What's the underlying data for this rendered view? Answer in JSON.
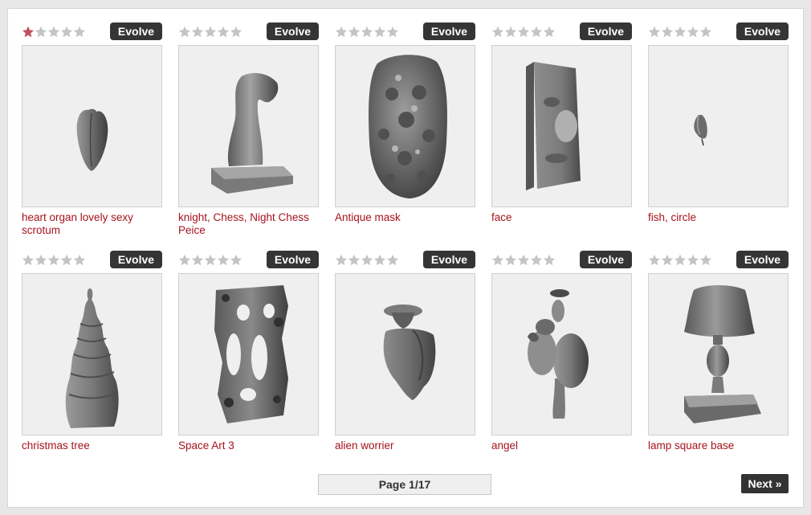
{
  "colors": {
    "star_empty": "#c4c4c4",
    "star_filled": "#c0505a",
    "title": "#a6121d",
    "button": "#353535"
  },
  "items": [
    {
      "title": "heart organ lovely sexy scrotum",
      "rating": 1,
      "evolve_label": "Evolve",
      "icon": "heart-shape"
    },
    {
      "title": "knight, Chess, Night Chess Peice",
      "rating": 0,
      "evolve_label": "Evolve",
      "icon": "chess-knight-shape"
    },
    {
      "title": "Antique mask",
      "rating": 0,
      "evolve_label": "Evolve",
      "icon": "mask-shape"
    },
    {
      "title": "face",
      "rating": 0,
      "evolve_label": "Evolve",
      "icon": "face-shape"
    },
    {
      "title": "fish, circle",
      "rating": 0,
      "evolve_label": "Evolve",
      "icon": "fish-shape"
    },
    {
      "title": "christmas tree",
      "rating": 0,
      "evolve_label": "Evolve",
      "icon": "tree-shape"
    },
    {
      "title": "Space Art 3",
      "rating": 0,
      "evolve_label": "Evolve",
      "icon": "space-art-shape"
    },
    {
      "title": "alien worrier",
      "rating": 0,
      "evolve_label": "Evolve",
      "icon": "alien-shape"
    },
    {
      "title": "angel",
      "rating": 0,
      "evolve_label": "Evolve",
      "icon": "angel-shape"
    },
    {
      "title": "lamp square base",
      "rating": 0,
      "evolve_label": "Evolve",
      "icon": "lamp-shape"
    }
  ],
  "pagination": {
    "page_label": "Page 1/17",
    "next_label": "Next »"
  }
}
